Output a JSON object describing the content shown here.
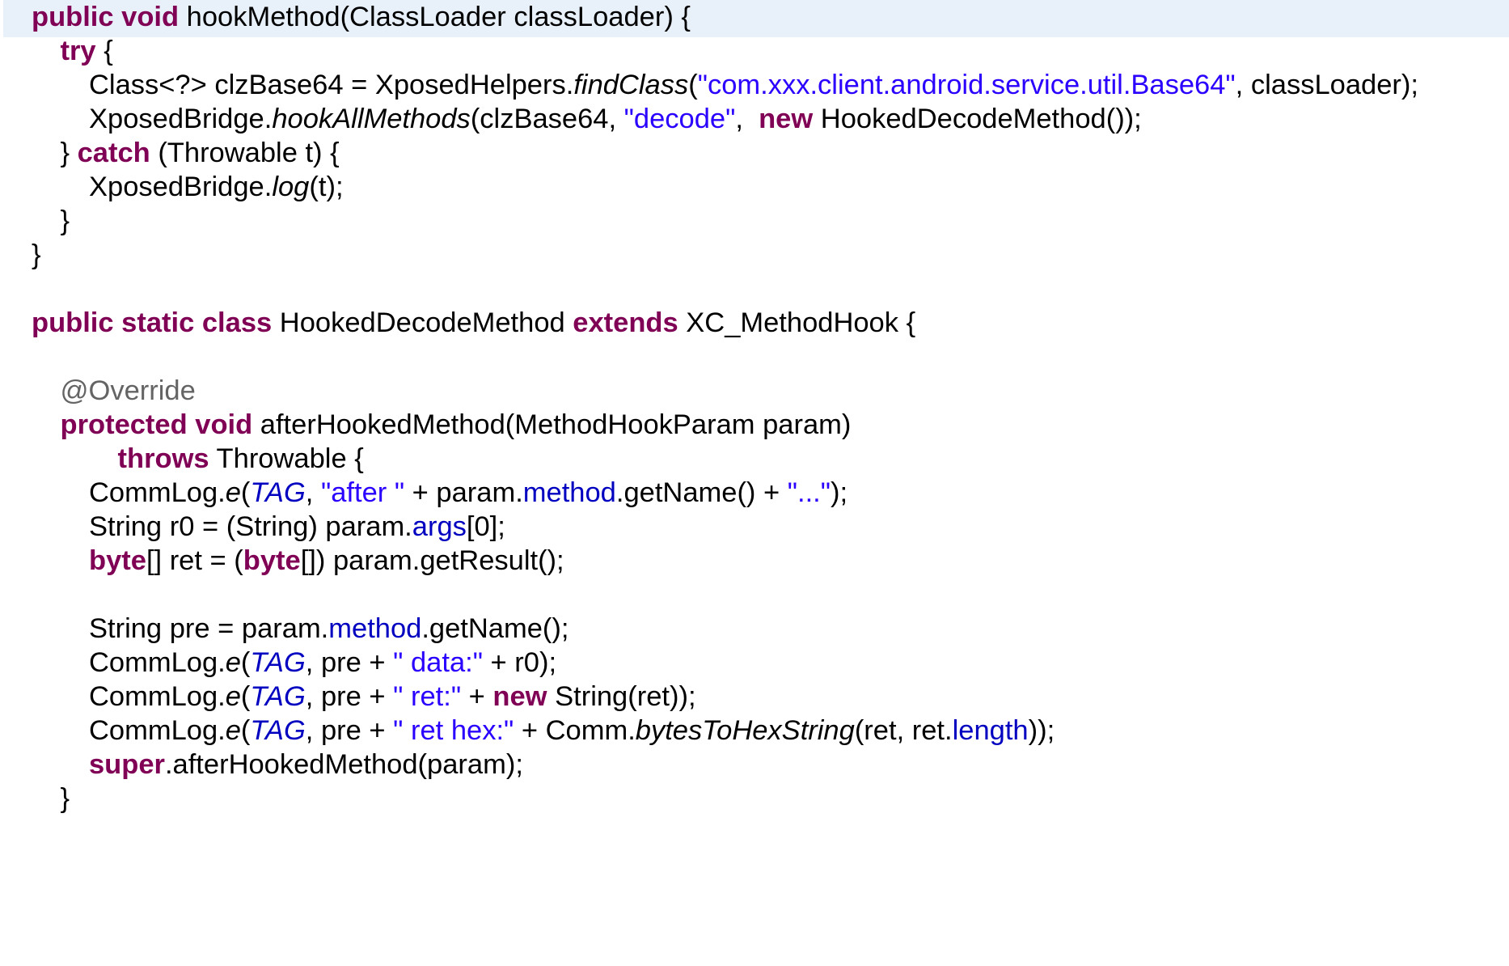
{
  "editor": {
    "colors": {
      "background": "#ffffff",
      "current_line": "#e8f0fa",
      "keyword": "#7f0055",
      "string": "#2a00ff",
      "field": "#0000c0",
      "annotation": "#646464",
      "text": "#000000"
    },
    "highlighted_line": 0,
    "lines": [
      {
        "indent": 0,
        "tokens": [
          {
            "t": "kw",
            "v": "public void"
          },
          {
            "t": "plain",
            "v": " hookMethod(ClassLoader classLoader) {"
          }
        ]
      },
      {
        "indent": 1,
        "tokens": [
          {
            "t": "kw",
            "v": "try"
          },
          {
            "t": "plain",
            "v": " {"
          }
        ]
      },
      {
        "indent": 2,
        "tokens": [
          {
            "t": "plain",
            "v": "Class<?> clzBase64 = XposedHelpers."
          },
          {
            "t": "it",
            "v": "findClass"
          },
          {
            "t": "plain",
            "v": "("
          },
          {
            "t": "str",
            "v": "\"com.xxx.client.android.service.util.Base64\""
          },
          {
            "t": "plain",
            "v": ", classLoader);"
          }
        ]
      },
      {
        "indent": 2,
        "tokens": [
          {
            "t": "plain",
            "v": "XposedBridge."
          },
          {
            "t": "it",
            "v": "hookAllMethods"
          },
          {
            "t": "plain",
            "v": "(clzBase64, "
          },
          {
            "t": "str",
            "v": "\"decode\""
          },
          {
            "t": "plain",
            "v": ",  "
          },
          {
            "t": "kw",
            "v": "new"
          },
          {
            "t": "plain",
            "v": " HookedDecodeMethod());"
          }
        ]
      },
      {
        "indent": 1,
        "tokens": [
          {
            "t": "plain",
            "v": "} "
          },
          {
            "t": "kw",
            "v": "catch"
          },
          {
            "t": "plain",
            "v": " (Throwable t) {"
          }
        ]
      },
      {
        "indent": 2,
        "tokens": [
          {
            "t": "plain",
            "v": "XposedBridge."
          },
          {
            "t": "it",
            "v": "log"
          },
          {
            "t": "plain",
            "v": "(t);"
          }
        ]
      },
      {
        "indent": 1,
        "tokens": [
          {
            "t": "plain",
            "v": "}"
          }
        ]
      },
      {
        "indent": 0,
        "tokens": [
          {
            "t": "plain",
            "v": "}"
          }
        ]
      },
      {
        "indent": 0,
        "tokens": []
      },
      {
        "indent": 0,
        "tokens": [
          {
            "t": "kw",
            "v": "public static class"
          },
          {
            "t": "plain",
            "v": " HookedDecodeMethod "
          },
          {
            "t": "kw",
            "v": "extends"
          },
          {
            "t": "plain",
            "v": " XC_MethodHook {"
          }
        ]
      },
      {
        "indent": 0,
        "tokens": []
      },
      {
        "indent": 1,
        "tokens": [
          {
            "t": "ann",
            "v": "@Override"
          }
        ]
      },
      {
        "indent": 1,
        "tokens": [
          {
            "t": "kw",
            "v": "protected void"
          },
          {
            "t": "plain",
            "v": " afterHookedMethod(MethodHookParam param)"
          }
        ]
      },
      {
        "indent": 3,
        "tokens": [
          {
            "t": "kw",
            "v": "throws"
          },
          {
            "t": "plain",
            "v": " Throwable {"
          }
        ]
      },
      {
        "indent": 2,
        "tokens": [
          {
            "t": "plain",
            "v": "CommLog."
          },
          {
            "t": "it",
            "v": "e"
          },
          {
            "t": "plain",
            "v": "("
          },
          {
            "t": "static",
            "v": "TAG"
          },
          {
            "t": "plain",
            "v": ", "
          },
          {
            "t": "str",
            "v": "\"after \""
          },
          {
            "t": "plain",
            "v": " + param."
          },
          {
            "t": "field",
            "v": "method"
          },
          {
            "t": "plain",
            "v": ".getName() + "
          },
          {
            "t": "str",
            "v": "\"...\""
          },
          {
            "t": "plain",
            "v": ");"
          }
        ]
      },
      {
        "indent": 2,
        "tokens": [
          {
            "t": "plain",
            "v": "String r0 = (String) param."
          },
          {
            "t": "field",
            "v": "args"
          },
          {
            "t": "plain",
            "v": "[0];"
          }
        ]
      },
      {
        "indent": 2,
        "tokens": [
          {
            "t": "kw",
            "v": "byte"
          },
          {
            "t": "plain",
            "v": "[] ret = ("
          },
          {
            "t": "kw",
            "v": "byte"
          },
          {
            "t": "plain",
            "v": "[]) param.getResult();"
          }
        ]
      },
      {
        "indent": 0,
        "tokens": []
      },
      {
        "indent": 2,
        "tokens": [
          {
            "t": "plain",
            "v": "String pre = param."
          },
          {
            "t": "field",
            "v": "method"
          },
          {
            "t": "plain",
            "v": ".getName();"
          }
        ]
      },
      {
        "indent": 2,
        "tokens": [
          {
            "t": "plain",
            "v": "CommLog."
          },
          {
            "t": "it",
            "v": "e"
          },
          {
            "t": "plain",
            "v": "("
          },
          {
            "t": "static",
            "v": "TAG"
          },
          {
            "t": "plain",
            "v": ", pre + "
          },
          {
            "t": "str",
            "v": "\" data:\""
          },
          {
            "t": "plain",
            "v": " + r0);"
          }
        ]
      },
      {
        "indent": 2,
        "tokens": [
          {
            "t": "plain",
            "v": "CommLog."
          },
          {
            "t": "it",
            "v": "e"
          },
          {
            "t": "plain",
            "v": "("
          },
          {
            "t": "static",
            "v": "TAG"
          },
          {
            "t": "plain",
            "v": ", pre + "
          },
          {
            "t": "str",
            "v": "\" ret:\""
          },
          {
            "t": "plain",
            "v": " + "
          },
          {
            "t": "kw",
            "v": "new"
          },
          {
            "t": "plain",
            "v": " String(ret));"
          }
        ]
      },
      {
        "indent": 2,
        "tokens": [
          {
            "t": "plain",
            "v": "CommLog."
          },
          {
            "t": "it",
            "v": "e"
          },
          {
            "t": "plain",
            "v": "("
          },
          {
            "t": "static",
            "v": "TAG"
          },
          {
            "t": "plain",
            "v": ", pre + "
          },
          {
            "t": "str",
            "v": "\" ret hex:\""
          },
          {
            "t": "plain",
            "v": " + Comm."
          },
          {
            "t": "it",
            "v": "bytesToHexString"
          },
          {
            "t": "plain",
            "v": "(ret, ret."
          },
          {
            "t": "field",
            "v": "length"
          },
          {
            "t": "plain",
            "v": "));"
          }
        ]
      },
      {
        "indent": 2,
        "tokens": [
          {
            "t": "kw",
            "v": "super"
          },
          {
            "t": "plain",
            "v": ".afterHookedMethod(param);"
          }
        ]
      },
      {
        "indent": 1,
        "tokens": [
          {
            "t": "plain",
            "v": "}"
          }
        ]
      }
    ]
  }
}
